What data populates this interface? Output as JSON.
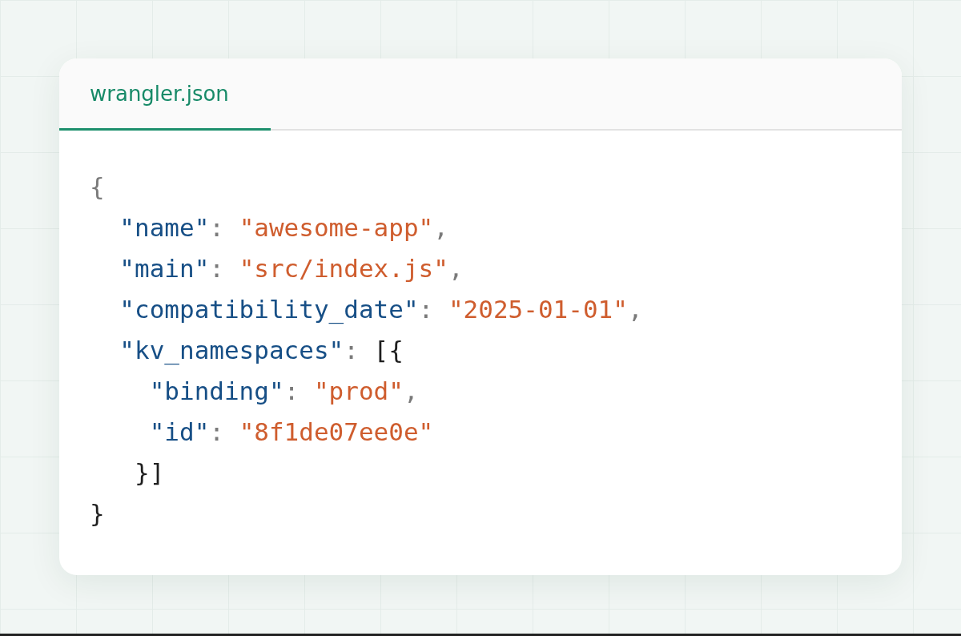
{
  "tabs": [
    {
      "label": "wrangler.json",
      "selected": true
    }
  ],
  "code": [
    {
      "tokens": [
        {
          "kind": "punct",
          "text": "{"
        }
      ],
      "children": [
        {
          "tokens": [
            {
              "kind": "key",
              "text": "\"name\""
            },
            {
              "kind": "punct",
              "text": ": "
            },
            {
              "kind": "string",
              "text": "\"awesome-app\""
            },
            {
              "kind": "punct",
              "text": ","
            }
          ]
        },
        {
          "tokens": [
            {
              "kind": "key",
              "text": "\"main\""
            },
            {
              "kind": "punct",
              "text": ": "
            },
            {
              "kind": "string",
              "text": "\"src/index.js\""
            },
            {
              "kind": "punct",
              "text": ","
            }
          ]
        },
        {
          "tokens": [
            {
              "kind": "key",
              "text": "\"compatibility_date\""
            },
            {
              "kind": "punct",
              "text": ": "
            },
            {
              "kind": "string",
              "text": "\"2025-01-01\""
            },
            {
              "kind": "punct",
              "text": ","
            }
          ]
        },
        {
          "tokens": [
            {
              "kind": "key",
              "text": "\"kv_namespaces\""
            },
            {
              "kind": "punct",
              "text": ": "
            },
            {
              "kind": "bracket",
              "text": "[{"
            }
          ],
          "children": [
            {
              "tokens": [
                {
                  "kind": "key",
                  "text": "\"binding\""
                },
                {
                  "kind": "punct",
                  "text": ": "
                },
                {
                  "kind": "string",
                  "text": "\"prod\""
                },
                {
                  "kind": "punct",
                  "text": ","
                }
              ]
            },
            {
              "tokens": [
                {
                  "kind": "key",
                  "text": "\"id\""
                },
                {
                  "kind": "punct",
                  "text": ": "
                },
                {
                  "kind": "string",
                  "text": "\"8f1de07ee0e\""
                }
              ]
            }
          ]
        },
        {
          "tokens": [
            {
              "kind": "bracket",
              "text": "}]"
            }
          ]
        }
      ]
    },
    {
      "tokens": [
        {
          "kind": "bracket",
          "text": "}"
        }
      ]
    }
  ]
}
